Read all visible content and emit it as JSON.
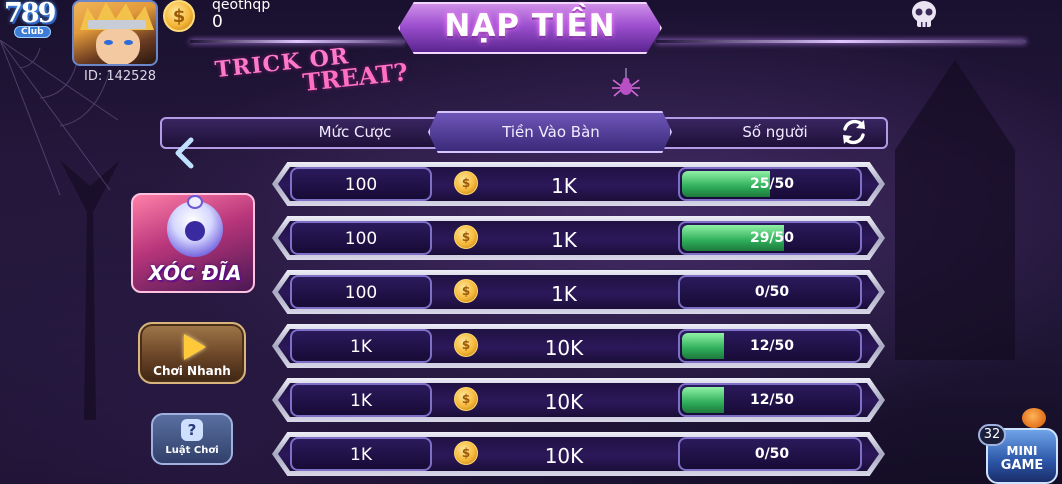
{
  "app": {
    "logo_number": "789",
    "logo_sub": "Club"
  },
  "user": {
    "name": "qeothqp",
    "balance": "0",
    "id_label": "ID: 142528",
    "coin_glyph": "$"
  },
  "header": {
    "deposit_banner": "NẠP TIỀN"
  },
  "decor": {
    "trick_line1": "TRICK OR",
    "trick_line2": "TREAT?"
  },
  "table": {
    "columns": [
      "Mức Cược",
      "Tiền Vào Bàn",
      "Số người"
    ],
    "rows": [
      {
        "bet": "100",
        "pot": "1K",
        "players": "25/50",
        "fill": 0.5
      },
      {
        "bet": "100",
        "pot": "1K",
        "players": "29/50",
        "fill": 0.58
      },
      {
        "bet": "100",
        "pot": "1K",
        "players": "0/50",
        "fill": 0
      },
      {
        "bet": "1K",
        "pot": "10K",
        "players": "12/50",
        "fill": 0.24
      },
      {
        "bet": "1K",
        "pot": "10K",
        "players": "12/50",
        "fill": 0.24
      },
      {
        "bet": "1K",
        "pot": "10K",
        "players": "0/50",
        "fill": 0
      }
    ]
  },
  "sidebar": {
    "game_name": "XÓC ĐĨA",
    "quick_play_label": "Chơi Nhanh",
    "rules_label": "Luật Chơi",
    "rules_glyph": "?"
  },
  "mini_game": {
    "badge": "32",
    "line1": "MINI",
    "line2": "GAME"
  },
  "colors": {
    "progress_fill": "#3dbb66",
    "accent": "#b49be6"
  }
}
